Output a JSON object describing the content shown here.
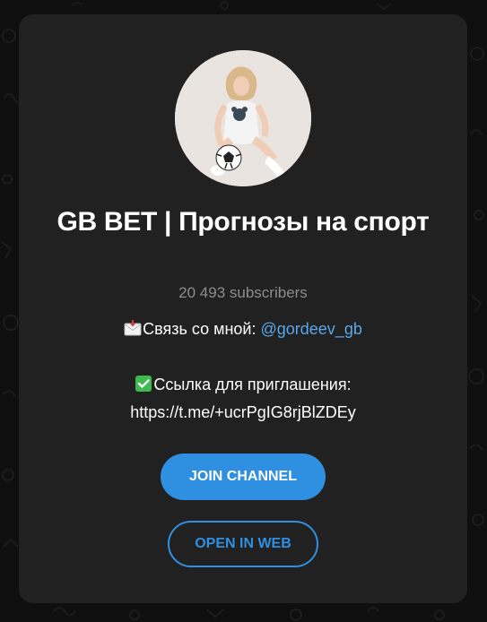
{
  "channel": {
    "title": "GB BET | Прогнозы на спорт",
    "subscribers": "20 493 subscribers",
    "avatar_icon": "channel-avatar-photo"
  },
  "description": {
    "contact_label": "Связь со мной: ",
    "contact_link": "@gordeev_gb",
    "contact_icon": "envelope-icon",
    "invite_label": "Ссылка для приглашения:",
    "invite_icon": "check-mark-icon",
    "invite_url": "https://t.me/+ucrPgIG8rjBlZDEy"
  },
  "buttons": {
    "join_label": "JOIN CHANNEL",
    "web_label": "OPEN IN WEB"
  },
  "colors": {
    "accent": "#2f8fe0",
    "link": "#5aa6ea",
    "card_bg": "#212121",
    "page_bg": "#0f0f0f"
  }
}
